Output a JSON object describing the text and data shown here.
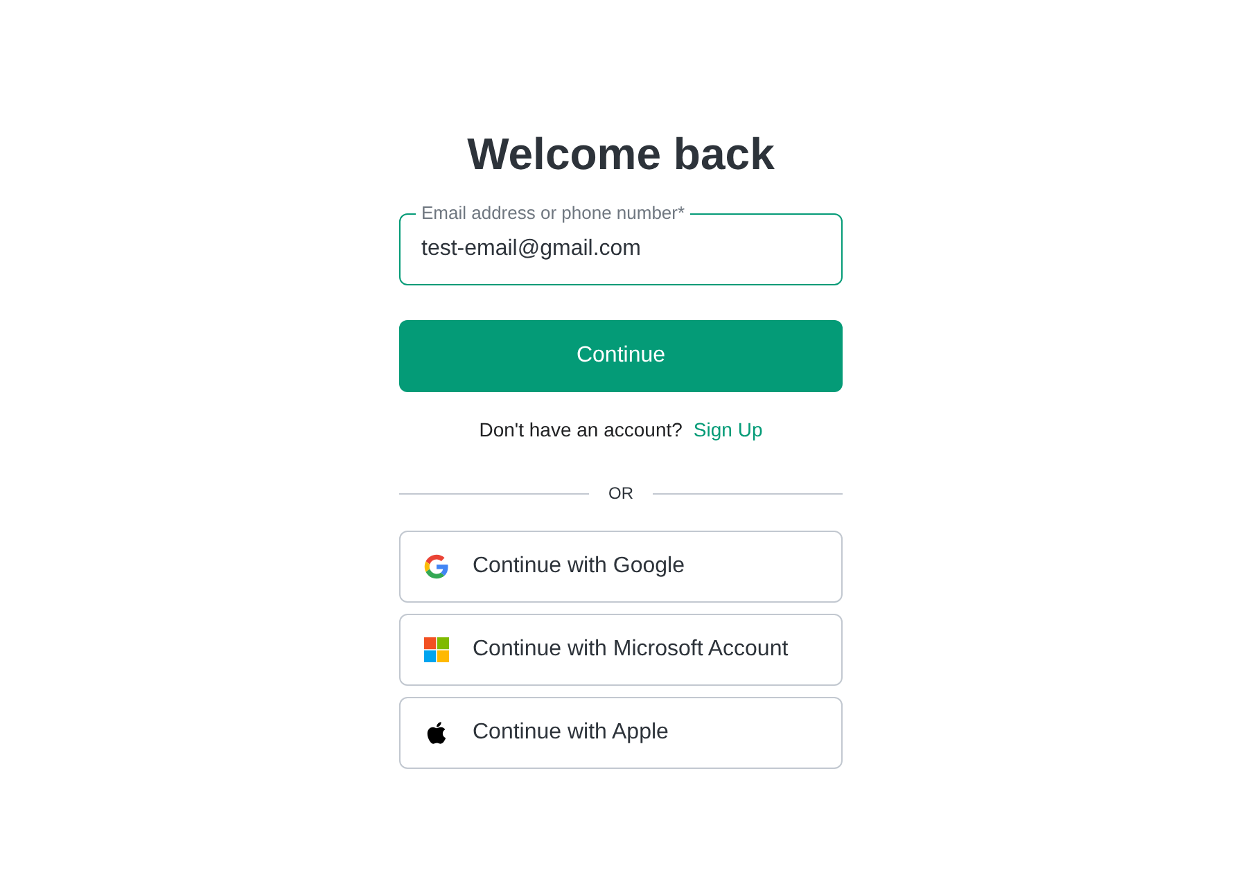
{
  "heading": {
    "title": "Welcome back"
  },
  "email_field": {
    "label": "Email address or phone number*",
    "value": "test-email@gmail.com",
    "focused": true
  },
  "continue_button": {
    "label": "Continue"
  },
  "signup_prompt": {
    "text": "Don't have an account?",
    "link": "Sign Up"
  },
  "divider": {
    "label": "OR"
  },
  "social_buttons": [
    {
      "kind": "google",
      "label": "Continue with Google"
    },
    {
      "kind": "microsoft",
      "label": "Continue with Microsoft Account"
    },
    {
      "kind": "apple",
      "label": "Continue with Apple"
    }
  ]
}
